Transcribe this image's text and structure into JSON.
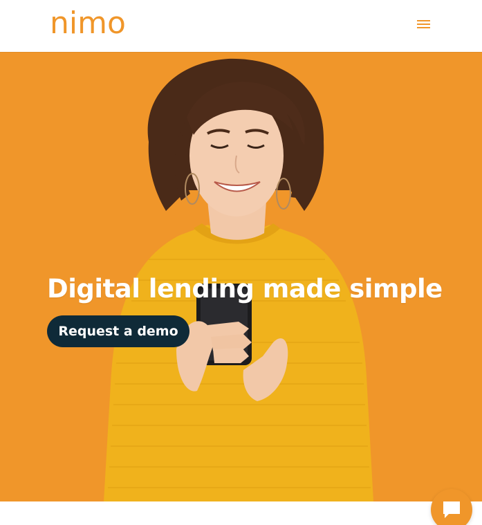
{
  "header": {
    "logo_text": "nimo",
    "menu_icon": "hamburger-menu-icon"
  },
  "hero": {
    "title": "Digital lending made simple",
    "cta_label": "Request a demo",
    "image": "woman-with-smartphone-photo"
  },
  "chat": {
    "icon": "chat-bubble-icon"
  },
  "colors": {
    "brand_orange": "#f0962a",
    "button_dark": "#0f2a38",
    "sweater_yellow": "#f0b21c"
  }
}
